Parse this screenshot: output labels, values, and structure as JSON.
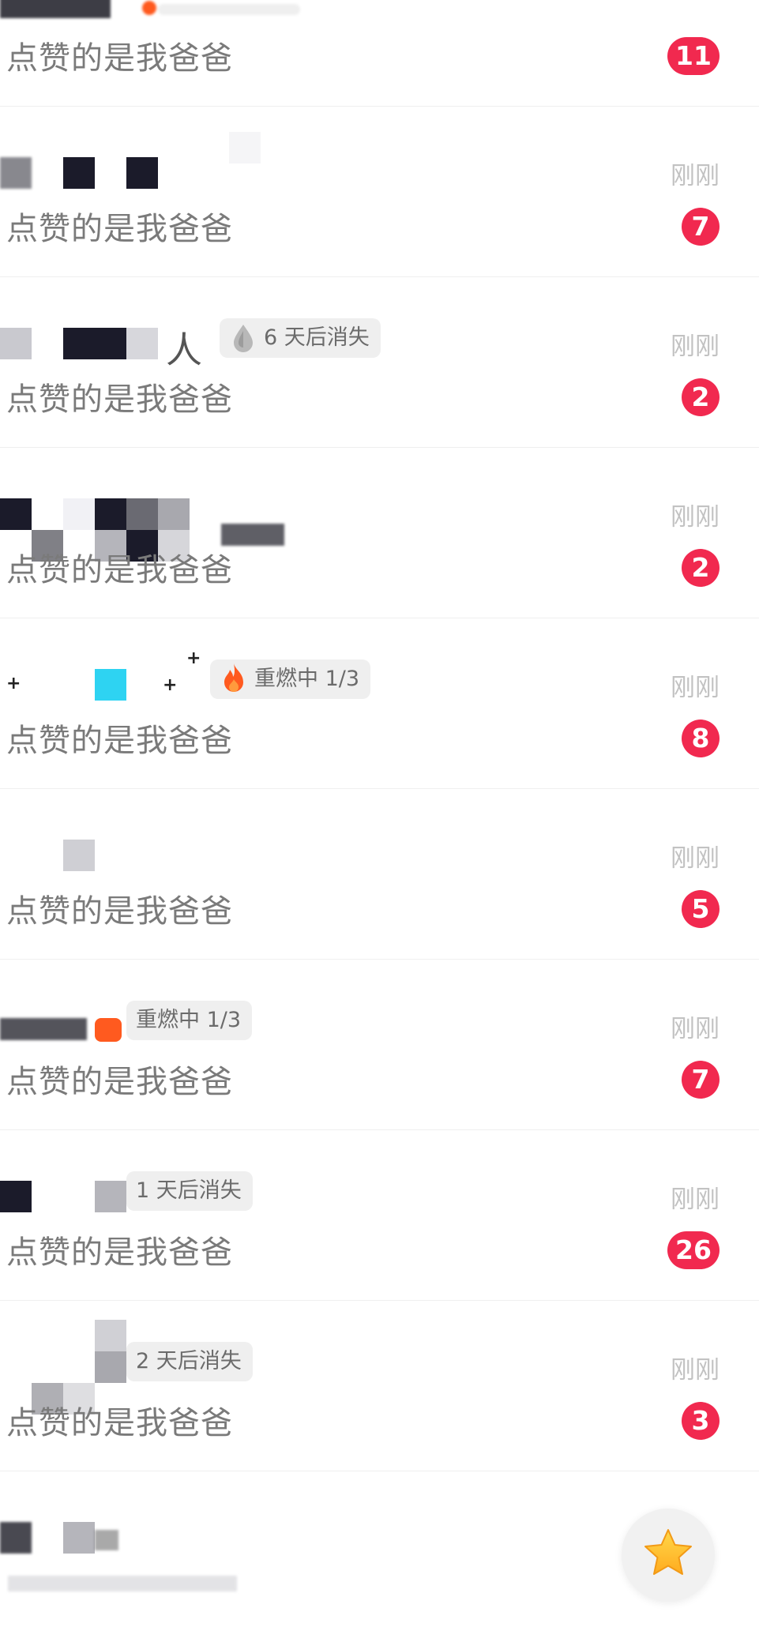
{
  "conversations": [
    {
      "time": "",
      "message": "点赞的是我爸爸",
      "badge": "11",
      "tag": null
    },
    {
      "time": "刚刚",
      "message": "点赞的是我爸爸",
      "badge": "7",
      "tag": null
    },
    {
      "time": "刚刚",
      "message": "点赞的是我爸爸",
      "badge": "2",
      "tag": {
        "icon": "drop-icon",
        "text": "6 天后消失"
      },
      "name_glyph": "人"
    },
    {
      "time": "刚刚",
      "message": "点赞的是我爸爸",
      "badge": "2",
      "tag": null
    },
    {
      "time": "刚刚",
      "message": "点赞的是我爸爸",
      "badge": "8",
      "tag": {
        "icon": "flame-icon",
        "text": "重燃中 1/3"
      }
    },
    {
      "time": "刚刚",
      "message": "点赞的是我爸爸",
      "badge": "5",
      "tag": null
    },
    {
      "time": "刚刚",
      "message": "点赞的是我爸爸",
      "badge": "7",
      "tag": {
        "icon": "flame-icon",
        "text": "重燃中 1/3"
      }
    },
    {
      "time": "刚刚",
      "message": "点赞的是我爸爸",
      "badge": "26",
      "tag": {
        "icon": "none",
        "text": "1 天后消失"
      }
    },
    {
      "time": "刚刚",
      "message": "点赞的是我爸爸",
      "badge": "3",
      "tag": {
        "icon": "none",
        "text": "2 天后消失"
      }
    },
    {
      "time": "",
      "message": "",
      "badge": "",
      "tag": null
    }
  ],
  "fab": {
    "icon": "star-icon"
  },
  "colors": {
    "badge": "#f1294f",
    "time": "#c2c2c2",
    "message": "#7a7a7a",
    "tag_bg": "#efefef",
    "flame": "#ff5a1f"
  }
}
